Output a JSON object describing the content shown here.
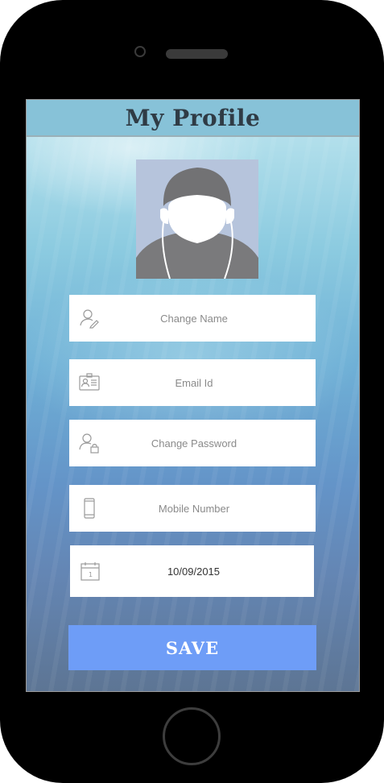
{
  "header": {
    "title": "My Profile"
  },
  "form": {
    "name_placeholder": "Change Name",
    "email_placeholder": "Email Id",
    "password_placeholder": "Change Password",
    "mobile_placeholder": "Mobile Number",
    "date_value": "10/09/2015"
  },
  "actions": {
    "save_label": "SAVE"
  },
  "icons": {
    "name": "user-edit-icon",
    "email": "id-card-icon",
    "password": "user-lock-icon",
    "mobile": "mobile-phone-icon",
    "date": "calendar-icon"
  },
  "colors": {
    "header_bg": "#87c2d8",
    "save_bg": "#6e9df7",
    "avatar_bg": "#b6c4dc"
  }
}
